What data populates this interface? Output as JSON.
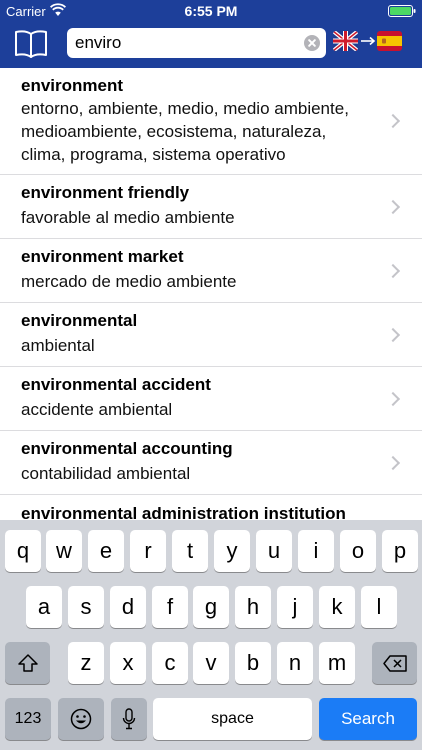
{
  "status_bar": {
    "carrier": "Carrier",
    "time": "6:55 PM"
  },
  "search": {
    "value": "enviro"
  },
  "language_pair": {
    "from_flag": "uk-flag-icon",
    "to_flag": "spain-flag-icon"
  },
  "colors": {
    "header_blue": "#1d3f9a",
    "search_key_blue": "#1b7cf6",
    "keyboard_bg": "#d1d4da"
  },
  "results": [
    {
      "term": "environment",
      "translation": "entorno, ambiente, medio, medio ambiente, medioambiente, ecosistema, naturaleza, clima, programa, sistema operativo"
    },
    {
      "term": "environment friendly",
      "translation": "favorable al medio ambiente"
    },
    {
      "term": "environment market",
      "translation": "mercado de medio ambiente"
    },
    {
      "term": "environmental",
      "translation": "ambiental"
    },
    {
      "term": "environmental accident",
      "translation": "accidente ambiental"
    },
    {
      "term": "environmental accounting",
      "translation": "contabilidad ambiental"
    },
    {
      "term": "environmental administration institution",
      "translation": ""
    }
  ],
  "keyboard": {
    "row1": [
      "q",
      "w",
      "e",
      "r",
      "t",
      "y",
      "u",
      "i",
      "o",
      "p"
    ],
    "row2": [
      "a",
      "s",
      "d",
      "f",
      "g",
      "h",
      "j",
      "k",
      "l"
    ],
    "row3": [
      "z",
      "x",
      "c",
      "v",
      "b",
      "n",
      "m"
    ],
    "numbers_label": "123",
    "space_label": "space",
    "search_label": "Search"
  }
}
